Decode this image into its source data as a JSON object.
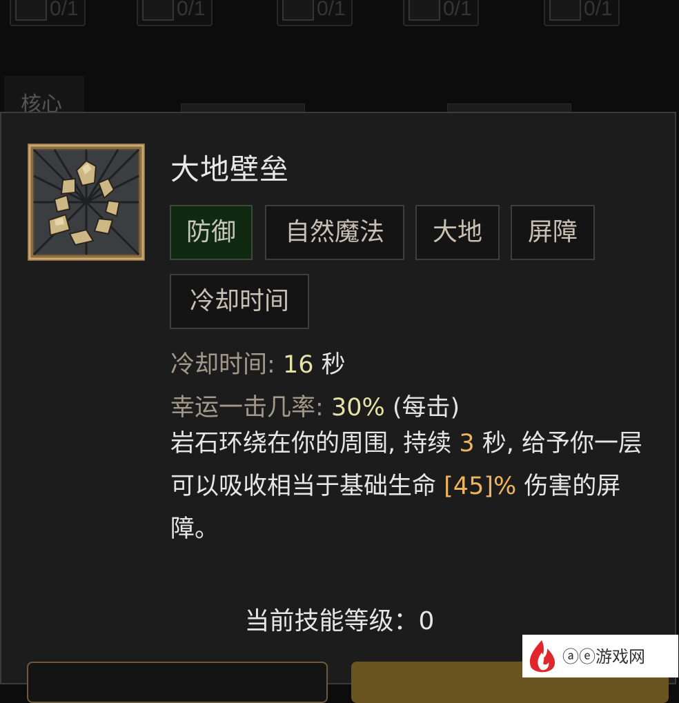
{
  "background": {
    "top_slots": [
      {
        "count": "0/1"
      },
      {
        "count": "0/1"
      },
      {
        "count": "0/1"
      },
      {
        "count": "0/1"
      },
      {
        "count": "0/1"
      }
    ],
    "core_tab": "核心"
  },
  "tooltip": {
    "icon": "earth-rocks-icon",
    "title": "大地壁垒",
    "tags": [
      "防御",
      "自然魔法",
      "大地",
      "屏障",
      "冷却时间"
    ],
    "active_tag_index": 0,
    "cooldown": {
      "label": "冷却时间:",
      "value": "16",
      "unit": "秒"
    },
    "lucky_hit": {
      "label": "幸运一击几率:",
      "value": "30%",
      "extra": "(每击)"
    },
    "description": {
      "part1": "岩石环绕在你的周围, 持续 ",
      "duration": "3",
      "part2": " 秒, 给予你一层可以吸收相当于基础生命 ",
      "percent": "[45]%",
      "part3": " 伤害的屏障。"
    },
    "level_line": "当前技能等级：0"
  },
  "watermark": {
    "text": "ⓐⓔ游戏网"
  },
  "colors": {
    "panel_bg": "#1c1c1c",
    "active_tag_bg": "#0f2a10",
    "value_yellow": "#e7e2a8",
    "highlight_orange": "#f0b45c",
    "label_tan": "#a3998a"
  }
}
